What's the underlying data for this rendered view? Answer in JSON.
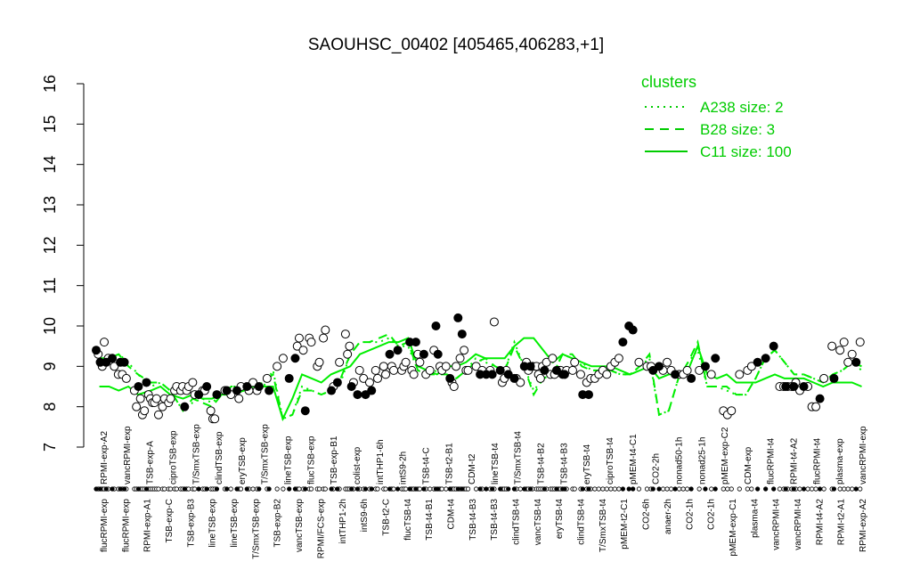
{
  "chart_data": {
    "type": "line",
    "title": "SAOUHSC_00402 [405465,406283,+1]",
    "xlabel": "",
    "ylabel": "",
    "ylim": [
      7,
      16
    ],
    "yticks": [
      7,
      8,
      9,
      10,
      11,
      12,
      13,
      14,
      15,
      16
    ],
    "grid": false,
    "legend": {
      "title": "clusters",
      "position": "top-right",
      "entries": [
        {
          "label": "A238 size: 2",
          "style": "dotted"
        },
        {
          "label": "B28 size: 3",
          "style": "dashed"
        },
        {
          "label": "C11 size: 100",
          "style": "solid"
        }
      ]
    },
    "x_labels_top": [
      "RPMI-exp-A2",
      "vancRPMI-exp",
      "TSB-exp-A",
      "ciproTSB-exp",
      "T/SmxTSB-exp",
      "clindTSB-exp",
      "eryTSB-exp",
      "T/SmxTSB-exp",
      "lineTSB-exp",
      "flucTSB-exp",
      "TSB-exp-B1",
      "colist-exp",
      "intTHP1-6h",
      "intS9-2h",
      "TSB-t4-C",
      "TSB-t2-B1",
      "CDM-t2",
      "lineTSB-t4",
      "T/SmxTSB-t4",
      "TSB-t4-B2",
      "TSB-t4-B3",
      "eryTSB-t4",
      "ciproTSB-t4",
      "pMEM-t4-C1",
      "CO2-2h",
      "nonad50-1h",
      "nonad25-1h",
      "pMEM-exp-C2",
      "CDM-exp",
      "flucRPMI-t4",
      "RPMI-t4-A2",
      "flucRPMI-t4",
      "plasma-exp",
      "vancRPMI-exp"
    ],
    "x_labels_bottom": [
      "flucRPMI-exp",
      "flucRPMI-exp",
      "RPMI-exp-A1",
      "TSB-exp-C",
      "TSB-exp-B3",
      "lineTSB-exp",
      "lineTSB-exp",
      "T/SmxTSB-exp",
      "TSB-exp-B2",
      "vancTSB-exp",
      "RPMI/FCS-exp",
      "intTHP1-2h",
      "intS9-6h",
      "TSB-t2-C",
      "flucTSB-t4",
      "TSB-t4-B1",
      "CDM-t4",
      "TSB-t4-B3",
      "TSB-t4-B3",
      "clindTSB-t4",
      "vancTSB-t4",
      "eryTSB-t4",
      "clindTSB-t4",
      "T/SmxTSB-t4",
      "pMEM-t2-C1",
      "CO2-6h",
      "anaer-2h",
      "CO2-1h",
      "CO2-1h",
      "pMEM-exp-C1",
      "plasma-t4",
      "vancRPMI-t4",
      "vancRPMI-t4",
      "RPMI-t4-A2",
      "RPMI-t2-A1",
      "RPMI-exp-A2"
    ],
    "series": [
      {
        "name": "A238 size: 2",
        "style": "dotted",
        "x": [
          1,
          4,
          7,
          10,
          13,
          17,
          20,
          23,
          27,
          30,
          33,
          36,
          39,
          42,
          46,
          49,
          52,
          55,
          58,
          61,
          64,
          67,
          70,
          73,
          76,
          79,
          82,
          85,
          88,
          91,
          94,
          97,
          100,
          103,
          106,
          109,
          112,
          115,
          118,
          121,
          124,
          127,
          130,
          133,
          136,
          139,
          142,
          145,
          148,
          151,
          154,
          157,
          160,
          163,
          166,
          169,
          172,
          175,
          178,
          181,
          184,
          187,
          190,
          193,
          196,
          199,
          202,
          205,
          208,
          211,
          214,
          217,
          220,
          223,
          226,
          229,
          232,
          235,
          238
        ],
        "values": [
          9.3,
          9.2,
          9.3,
          9.1,
          8.8,
          8.5,
          8.6,
          8.4,
          7.9,
          8.1,
          8.2,
          8.1,
          8.3,
          8.5,
          8.5,
          8.5,
          8.5,
          8.9,
          7.7,
          7.8,
          8.5,
          8.4,
          8.3,
          8.4,
          8.6,
          9.3,
          9.6,
          9.6,
          9.6,
          9.7,
          9.5,
          9.5,
          8.9,
          8.8,
          8.9,
          8.8,
          8.7,
          8.9,
          9.2,
          9.1,
          9.0,
          8.9,
          9.6,
          9.0,
          8.4,
          8.7,
          8.8,
          9.3,
          9.2,
          9.1,
          8.9,
          8.9,
          8.9,
          8.8,
          8.8,
          9.0,
          9.2,
          7.8,
          7.9,
          8.7,
          9.1,
          9.4,
          8.5,
          8.5,
          8.4,
          8.3,
          8.3,
          8.7,
          9.2,
          9.4,
          9.1,
          8.8,
          8.8,
          8.7,
          8.6,
          8.8,
          8.9,
          9.1,
          8.9
        ]
      },
      {
        "name": "B28 size: 3",
        "style": "dashed",
        "x": [
          1,
          4,
          7,
          10,
          13,
          17,
          20,
          23,
          27,
          30,
          33,
          36,
          39,
          42,
          46,
          49,
          52,
          55,
          58,
          61,
          64,
          67,
          70,
          73,
          76,
          79,
          82,
          85,
          88,
          91,
          94,
          97,
          100,
          103,
          106,
          109,
          112,
          115,
          118,
          121,
          124,
          127,
          130,
          133,
          136,
          139,
          142,
          145,
          148,
          151,
          154,
          157,
          160,
          163,
          166,
          169,
          172,
          175,
          178,
          181,
          184,
          187,
          190,
          193,
          196,
          199,
          202,
          205,
          208,
          211,
          214,
          217,
          220,
          223,
          226,
          229,
          232,
          235,
          238
        ],
        "values": [
          9.2,
          9.2,
          9.3,
          9.0,
          8.8,
          8.6,
          8.6,
          8.4,
          7.9,
          8.2,
          8.1,
          8.0,
          8.3,
          8.5,
          8.5,
          8.5,
          8.6,
          8.8,
          7.7,
          7.8,
          8.4,
          8.4,
          8.3,
          8.4,
          8.7,
          9.3,
          9.6,
          9.6,
          9.7,
          9.8,
          9.5,
          9.6,
          8.9,
          8.8,
          8.8,
          8.8,
          8.7,
          8.9,
          9.1,
          9.2,
          9.0,
          8.9,
          9.5,
          9.0,
          8.3,
          8.7,
          8.8,
          9.3,
          9.3,
          9.0,
          8.9,
          8.9,
          8.9,
          8.8,
          8.8,
          9.0,
          9.3,
          7.8,
          7.9,
          8.7,
          9.1,
          9.6,
          8.5,
          8.5,
          8.5,
          8.3,
          8.3,
          8.7,
          9.2,
          9.4,
          9.1,
          8.8,
          8.8,
          8.7,
          8.6,
          8.8,
          8.9,
          9.1,
          9.0
        ]
      },
      {
        "name": "C11 size: 100",
        "style": "solid",
        "x": [
          1,
          4,
          7,
          10,
          13,
          17,
          20,
          23,
          27,
          30,
          33,
          36,
          39,
          42,
          46,
          49,
          52,
          55,
          58,
          61,
          64,
          67,
          70,
          73,
          76,
          79,
          82,
          85,
          88,
          91,
          94,
          97,
          100,
          103,
          106,
          109,
          112,
          115,
          118,
          121,
          124,
          127,
          130,
          133,
          136,
          139,
          142,
          145,
          148,
          151,
          154,
          157,
          160,
          163,
          166,
          169,
          172,
          175,
          178,
          181,
          184,
          187,
          190,
          193,
          196,
          199,
          202,
          205,
          208,
          211,
          214,
          217,
          220,
          223,
          226,
          229,
          232,
          235,
          238
        ],
        "values": [
          8.5,
          8.5,
          8.4,
          8.5,
          8.3,
          8.4,
          8.5,
          8.3,
          8.2,
          8.3,
          8.2,
          8.2,
          8.3,
          8.3,
          8.4,
          8.5,
          8.5,
          8.5,
          7.7,
          8.2,
          8.8,
          8.7,
          8.6,
          8.8,
          8.9,
          9.0,
          9.3,
          9.4,
          9.5,
          9.6,
          9.6,
          9.7,
          9.0,
          8.9,
          8.8,
          9.0,
          9.0,
          9.1,
          9.3,
          9.2,
          9.2,
          9.2,
          9.5,
          9.7,
          9.7,
          9.4,
          9.1,
          9.3,
          9.2,
          9.1,
          9.0,
          9.0,
          9.0,
          8.9,
          8.8,
          8.9,
          9.0,
          8.7,
          8.8,
          8.8,
          8.9,
          9.5,
          8.8,
          8.7,
          8.8,
          8.6,
          8.6,
          8.6,
          8.7,
          8.8,
          8.7,
          8.7,
          8.7,
          8.6,
          8.5,
          8.6,
          8.6,
          8.6,
          8.5
        ]
      }
    ],
    "points_filled": [
      [
        0,
        9.4
      ],
      [
        2,
        9.1
      ],
      [
        5,
        9.1
      ],
      [
        8,
        9.2
      ],
      [
        12,
        9.1
      ],
      [
        14,
        9.1
      ],
      [
        21,
        8.5
      ],
      [
        25,
        8.6
      ],
      [
        44,
        8.0
      ],
      [
        51,
        8.3
      ],
      [
        55,
        8.5
      ],
      [
        60,
        8.3
      ],
      [
        65,
        8.4
      ],
      [
        70,
        8.4
      ],
      [
        75,
        8.5
      ],
      [
        81,
        8.5
      ],
      [
        86,
        8.4
      ],
      [
        96,
        8.7
      ],
      [
        99,
        9.2
      ],
      [
        104,
        7.9
      ],
      [
        117,
        8.4
      ],
      [
        120,
        8.6
      ],
      [
        127,
        8.5
      ],
      [
        130,
        8.3
      ],
      [
        134,
        8.3
      ],
      [
        137,
        8.4
      ],
      [
        146,
        9.3
      ],
      [
        150,
        9.4
      ],
      [
        156,
        9.6
      ],
      [
        159,
        9.6
      ],
      [
        163,
        9.3
      ],
      [
        169,
        10.0
      ],
      [
        170,
        9.3
      ],
      [
        176,
        8.7
      ],
      [
        180,
        10.2
      ],
      [
        182,
        9.8
      ],
      [
        191,
        8.8
      ],
      [
        194,
        8.8
      ],
      [
        197,
        8.8
      ],
      [
        201,
        8.9
      ],
      [
        205,
        8.8
      ],
      [
        208,
        8.7
      ],
      [
        213,
        9.0
      ],
      [
        216,
        9.0
      ],
      [
        223,
        8.9
      ],
      [
        229,
        8.9
      ],
      [
        232,
        8.8
      ],
      [
        233,
        8.8
      ],
      [
        242,
        8.3
      ],
      [
        245,
        8.3
      ],
      [
        262,
        9.6
      ],
      [
        265,
        10.0
      ],
      [
        267,
        9.9
      ],
      [
        277,
        8.9
      ],
      [
        280,
        9.0
      ],
      [
        288,
        8.8
      ],
      [
        296,
        8.7
      ],
      [
        303,
        9.0
      ],
      [
        308,
        9.2
      ],
      [
        329,
        9.1
      ],
      [
        333,
        9.2
      ],
      [
        337,
        9.5
      ],
      [
        343,
        8.5
      ],
      [
        347,
        8.5
      ],
      [
        352,
        8.5
      ],
      [
        360,
        8.2
      ],
      [
        367,
        8.7
      ],
      [
        378,
        9.1
      ]
    ],
    "points_open": [
      [
        1,
        9.3
      ],
      [
        3,
        9.0
      ],
      [
        4,
        9.6
      ],
      [
        6,
        9.2
      ],
      [
        9,
        9.0
      ],
      [
        11,
        8.8
      ],
      [
        13,
        8.8
      ],
      [
        15,
        8.7
      ],
      [
        19,
        8.4
      ],
      [
        20,
        8.0
      ],
      [
        22,
        8.2
      ],
      [
        23,
        7.8
      ],
      [
        24,
        7.9
      ],
      [
        26,
        8.3
      ],
      [
        27,
        8.2
      ],
      [
        28,
        8.1
      ],
      [
        29,
        8.1
      ],
      [
        30,
        8.2
      ],
      [
        31,
        7.8
      ],
      [
        33,
        8.0
      ],
      [
        34,
        8.2
      ],
      [
        36,
        8.1
      ],
      [
        37,
        8.2
      ],
      [
        39,
        8.4
      ],
      [
        40,
        8.5
      ],
      [
        42,
        8.4
      ],
      [
        43,
        8.5
      ],
      [
        45,
        8.4
      ],
      [
        46,
        8.5
      ],
      [
        48,
        8.6
      ],
      [
        49,
        8.3
      ],
      [
        53,
        8.4
      ],
      [
        54,
        8.4
      ],
      [
        57,
        7.9
      ],
      [
        58,
        7.7
      ],
      [
        59,
        7.7
      ],
      [
        64,
        8.4
      ],
      [
        67,
        8.3
      ],
      [
        71,
        8.2
      ],
      [
        72,
        8.5
      ],
      [
        76,
        8.4
      ],
      [
        78,
        8.6
      ],
      [
        80,
        8.4
      ],
      [
        85,
        8.7
      ],
      [
        90,
        9.0
      ],
      [
        93,
        9.2
      ],
      [
        100,
        9.5
      ],
      [
        101,
        9.7
      ],
      [
        103,
        9.4
      ],
      [
        106,
        9.7
      ],
      [
        107,
        9.6
      ],
      [
        110,
        9.0
      ],
      [
        111,
        9.1
      ],
      [
        113,
        9.7
      ],
      [
        114,
        9.9
      ],
      [
        118,
        8.5
      ],
      [
        121,
        9.1
      ],
      [
        124,
        9.8
      ],
      [
        125,
        9.3
      ],
      [
        126,
        9.5
      ],
      [
        128,
        8.6
      ],
      [
        131,
        8.9
      ],
      [
        133,
        8.7
      ],
      [
        136,
        8.6
      ],
      [
        139,
        8.9
      ],
      [
        140,
        8.7
      ],
      [
        143,
        9.0
      ],
      [
        144,
        8.8
      ],
      [
        147,
        9.0
      ],
      [
        148,
        8.9
      ],
      [
        152,
        8.9
      ],
      [
        153,
        9.0
      ],
      [
        154,
        9.1
      ],
      [
        157,
        8.9
      ],
      [
        158,
        8.8
      ],
      [
        160,
        9.3
      ],
      [
        161,
        9.1
      ],
      [
        164,
        8.8
      ],
      [
        166,
        8.9
      ],
      [
        168,
        9.4
      ],
      [
        171,
        9.0
      ],
      [
        172,
        8.9
      ],
      [
        174,
        9.0
      ],
      [
        177,
        8.6
      ],
      [
        178,
        8.5
      ],
      [
        179,
        9.0
      ],
      [
        181,
        9.2
      ],
      [
        183,
        9.4
      ],
      [
        184,
        8.9
      ],
      [
        185,
        8.9
      ],
      [
        189,
        9.0
      ],
      [
        192,
        8.9
      ],
      [
        196,
        8.9
      ],
      [
        198,
        10.1
      ],
      [
        202,
        8.6
      ],
      [
        203,
        8.7
      ],
      [
        204,
        8.9
      ],
      [
        209,
        8.7
      ],
      [
        211,
        8.6
      ],
      [
        214,
        9.1
      ],
      [
        215,
        8.9
      ],
      [
        217,
        9.0
      ],
      [
        219,
        9.0
      ],
      [
        220,
        8.8
      ],
      [
        221,
        8.7
      ],
      [
        222,
        9.0
      ],
      [
        224,
        9.1
      ],
      [
        226,
        8.8
      ],
      [
        227,
        9.2
      ],
      [
        228,
        8.8
      ],
      [
        230,
        8.9
      ],
      [
        231,
        8.9
      ],
      [
        234,
        8.9
      ],
      [
        237,
        8.9
      ],
      [
        238,
        9.1
      ],
      [
        241,
        8.8
      ],
      [
        244,
        8.6
      ],
      [
        246,
        8.7
      ],
      [
        248,
        8.7
      ],
      [
        250,
        8.8
      ],
      [
        252,
        8.9
      ],
      [
        254,
        8.8
      ],
      [
        256,
        9.0
      ],
      [
        258,
        9.1
      ],
      [
        260,
        9.2
      ],
      [
        270,
        9.1
      ],
      [
        274,
        9.0
      ],
      [
        276,
        9.0
      ],
      [
        282,
        8.9
      ],
      [
        284,
        9.1
      ],
      [
        286,
        8.9
      ],
      [
        290,
        8.8
      ],
      [
        292,
        8.8
      ],
      [
        294,
        8.9
      ],
      [
        300,
        8.9
      ],
      [
        306,
        8.8
      ],
      [
        312,
        7.9
      ],
      [
        314,
        7.8
      ],
      [
        316,
        7.9
      ],
      [
        320,
        8.8
      ],
      [
        324,
        8.9
      ],
      [
        326,
        9.0
      ],
      [
        340,
        8.5
      ],
      [
        342,
        8.5
      ],
      [
        344,
        8.5
      ],
      [
        346,
        8.5
      ],
      [
        348,
        8.6
      ],
      [
        350,
        8.4
      ],
      [
        354,
        8.5
      ],
      [
        356,
        8.0
      ],
      [
        358,
        8.0
      ],
      [
        362,
        8.7
      ],
      [
        366,
        9.5
      ],
      [
        370,
        9.4
      ],
      [
        372,
        9.6
      ],
      [
        374,
        9.1
      ],
      [
        376,
        9.3
      ],
      [
        380,
        9.6
      ]
    ],
    "point_color": "#000000",
    "line_color": "#00ee00"
  }
}
